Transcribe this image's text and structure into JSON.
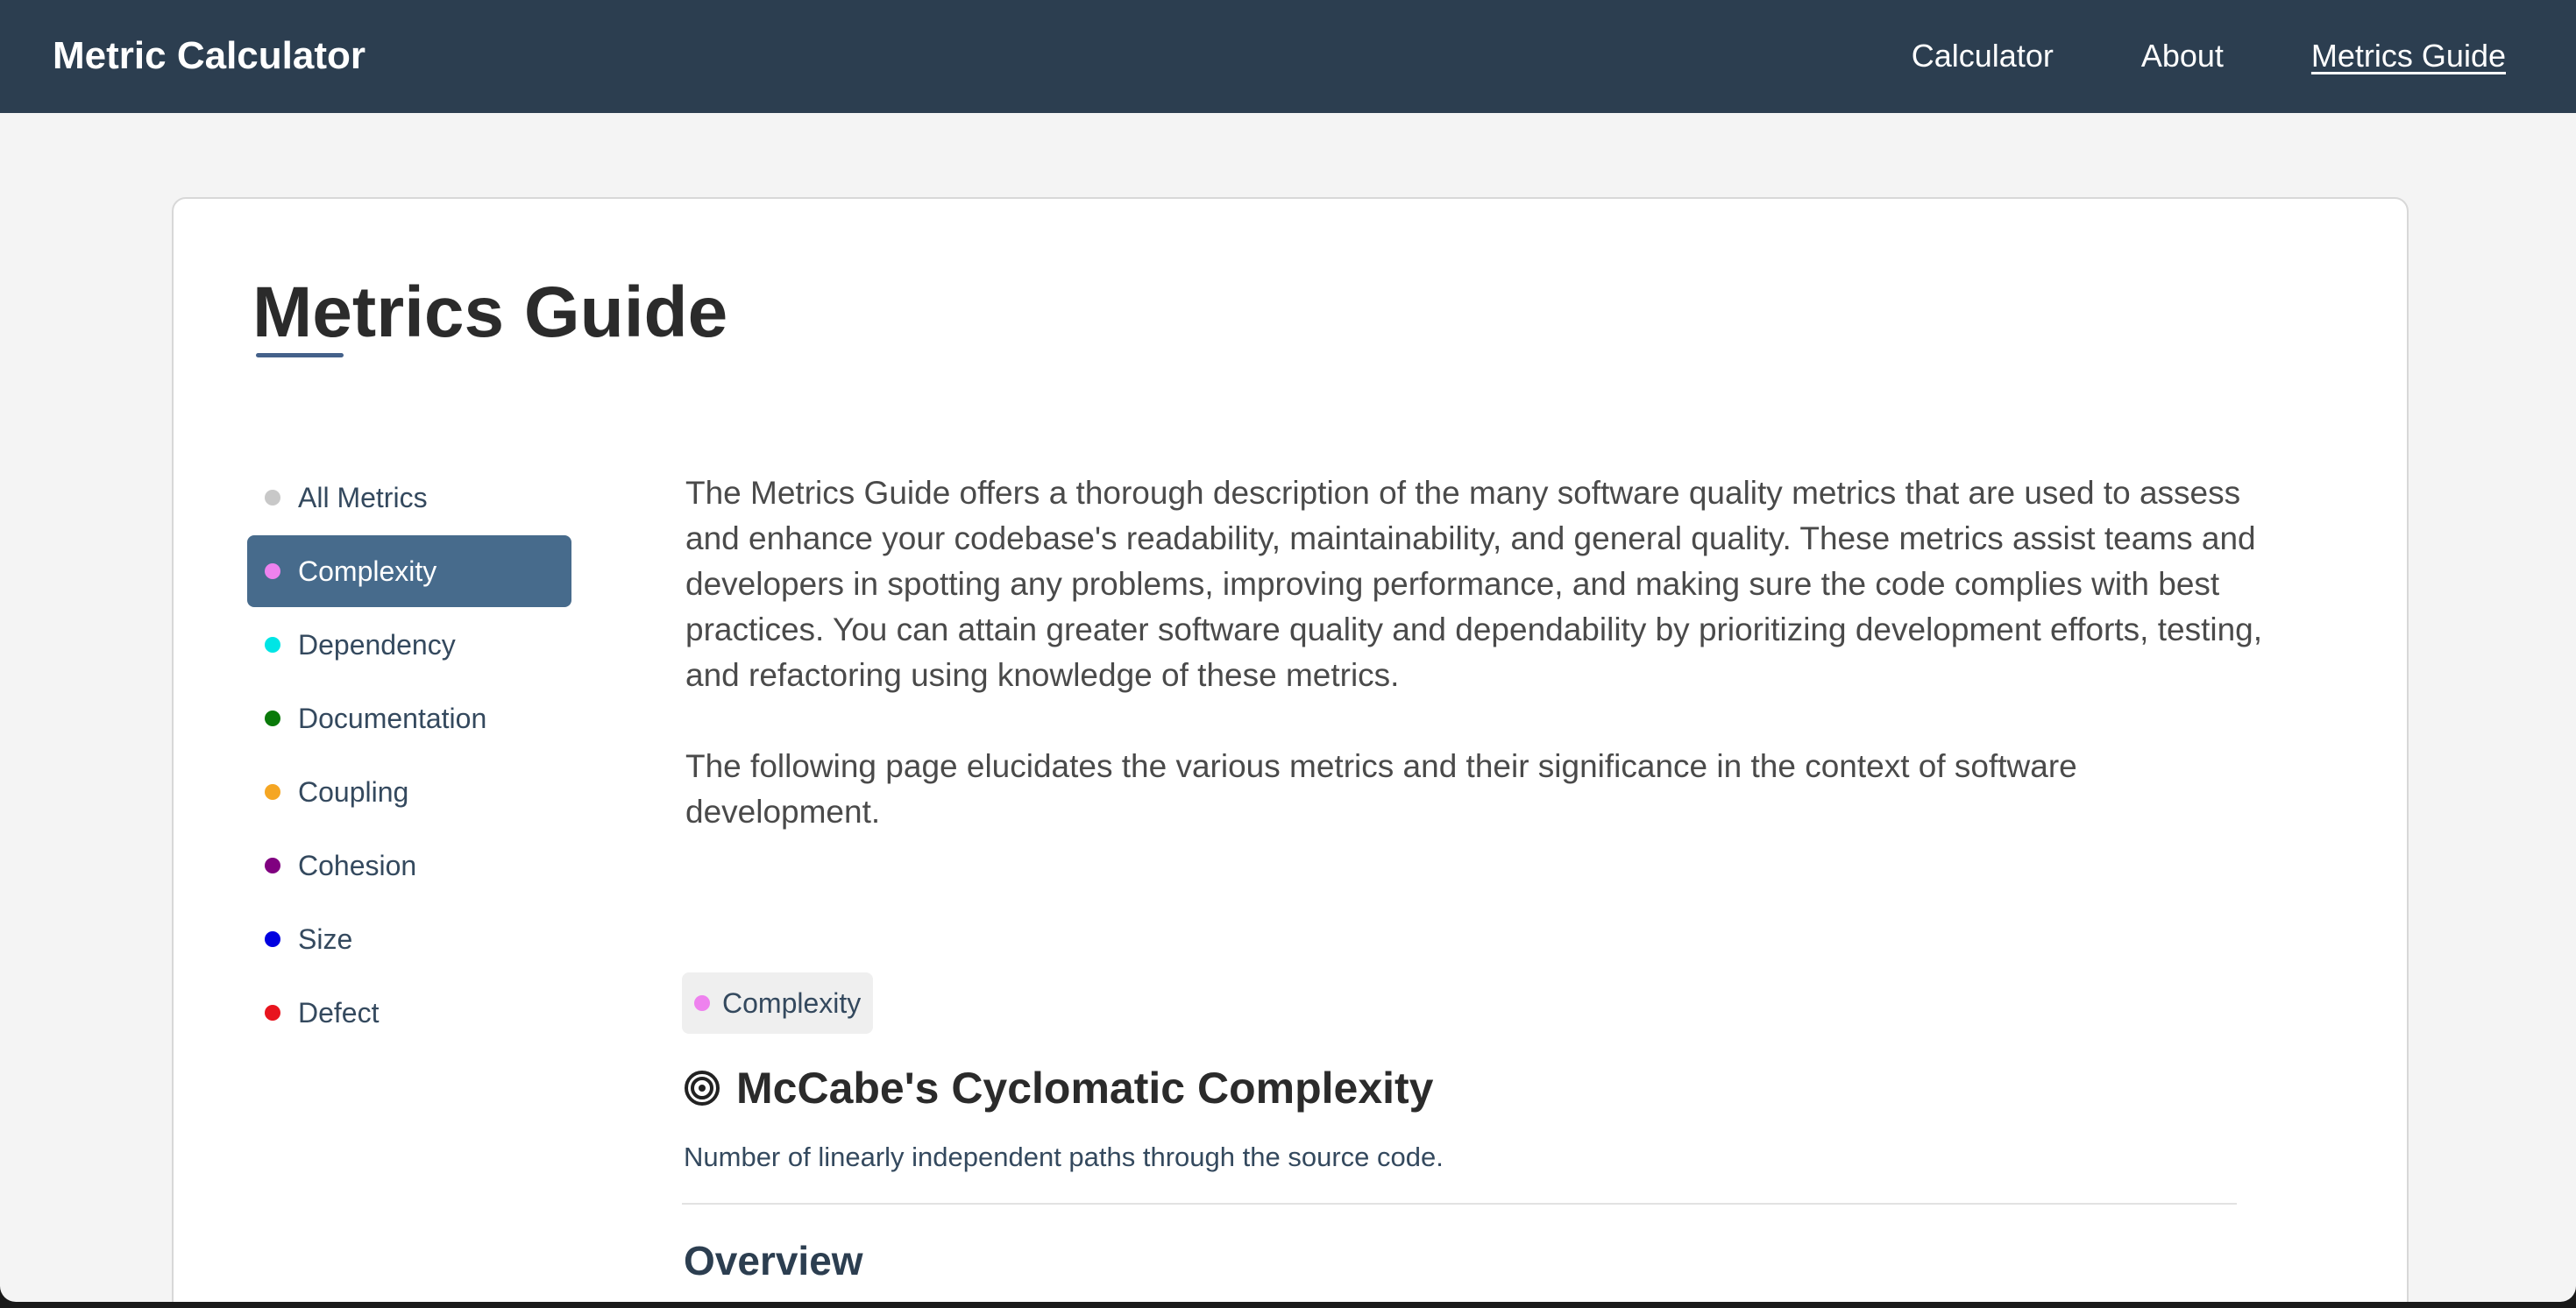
{
  "navbar": {
    "brand": "Metric Calculator",
    "links": [
      {
        "label": "Calculator",
        "active": false
      },
      {
        "label": "About",
        "active": false
      },
      {
        "label": "Metrics Guide",
        "active": true
      }
    ],
    "background": "#2c3e50"
  },
  "page": {
    "title": "Metrics Guide"
  },
  "sidebar": {
    "items": [
      {
        "label": "All Metrics",
        "color": "#c8c8c8",
        "active": false
      },
      {
        "label": "Complexity",
        "color": "#ee82ee",
        "active": true
      },
      {
        "label": "Dependency",
        "color": "#00e5e5",
        "active": false
      },
      {
        "label": "Documentation",
        "color": "#0a7a0a",
        "active": false
      },
      {
        "label": "Coupling",
        "color": "#f5a623",
        "active": false
      },
      {
        "label": "Cohesion",
        "color": "#800080",
        "active": false
      },
      {
        "label": "Size",
        "color": "#0000e0",
        "active": false
      },
      {
        "label": "Defect",
        "color": "#e8141e",
        "active": false
      }
    ],
    "active_background": "#476b8c"
  },
  "intro": {
    "paragraphs": [
      "The Metrics Guide offers a thorough description of the many software quality metrics that are used to assess and enhance your codebase's readability, maintainability, and general quality. These metrics assist teams and developers in spotting any problems, improving performance, and making sure the code complies with best practices. You can attain greater software quality and dependability by prioritizing development efforts, testing, and refactoring using knowledge of these metrics.",
      "The following page elucidates the various metrics and their significance in the context of software development."
    ]
  },
  "metric": {
    "tag": {
      "label": "Complexity",
      "color": "#ee82ee"
    },
    "icon": "target-icon",
    "title": "McCabe's Cyclomatic Complexity",
    "description": "Number of linearly independent paths through the source code.",
    "section_heading": "Overview"
  }
}
